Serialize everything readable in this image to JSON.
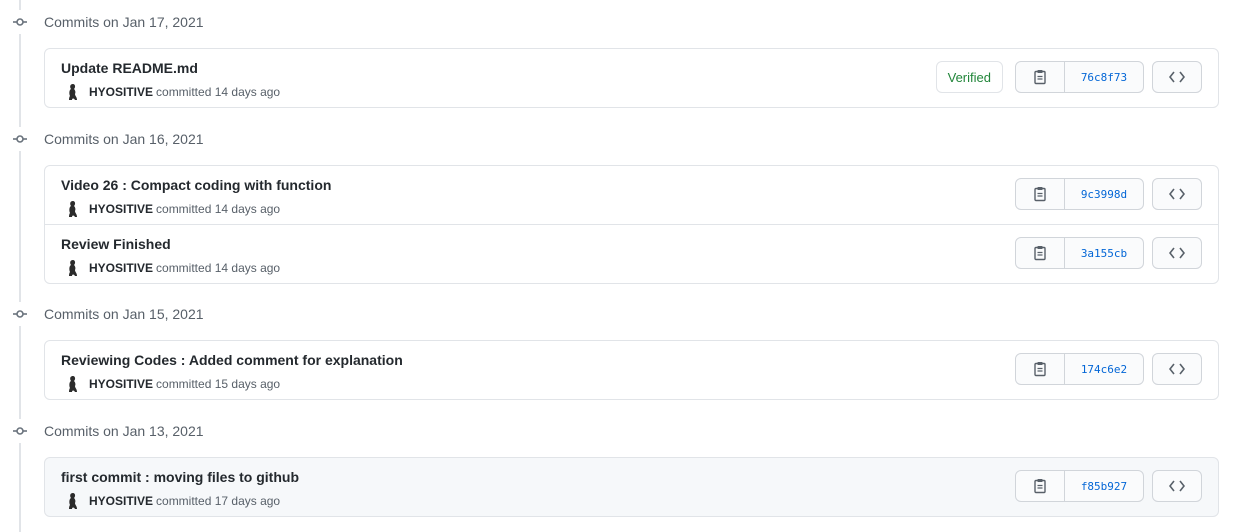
{
  "groups": [
    {
      "title": "Commits on Jan 17, 2021",
      "commits": [
        {
          "message": "Update README.md",
          "author": "HYOSITIVE",
          "action": "committed",
          "time": "14 days ago",
          "verified": "Verified",
          "sha": "76c8f73"
        }
      ]
    },
    {
      "title": "Commits on Jan 16, 2021",
      "commits": [
        {
          "message": "Video 26 : Compact coding with function",
          "author": "HYOSITIVE",
          "action": "committed",
          "time": "14 days ago",
          "sha": "9c3998d"
        },
        {
          "message": "Review Finished",
          "author": "HYOSITIVE",
          "action": "committed",
          "time": "14 days ago",
          "sha": "3a155cb"
        }
      ]
    },
    {
      "title": "Commits on Jan 15, 2021",
      "commits": [
        {
          "message": "Reviewing Codes : Added comment for explanation",
          "author": "HYOSITIVE",
          "action": "committed",
          "time": "15 days ago",
          "sha": "174c6e2"
        }
      ]
    },
    {
      "title": "Commits on Jan 13, 2021",
      "commits": [
        {
          "message": "first commit : moving files to github",
          "author": "HYOSITIVE",
          "action": "committed",
          "time": "17 days ago",
          "sha": "f85b927"
        }
      ]
    }
  ],
  "icons": {
    "node": "git-commit-icon",
    "copy": "clipboard-icon",
    "browse": "code-icon",
    "avatar": "avatar"
  },
  "colors": {
    "link": "#0366d6",
    "verified": "#22863a",
    "muted": "#586069",
    "border": "#e1e4e8"
  }
}
